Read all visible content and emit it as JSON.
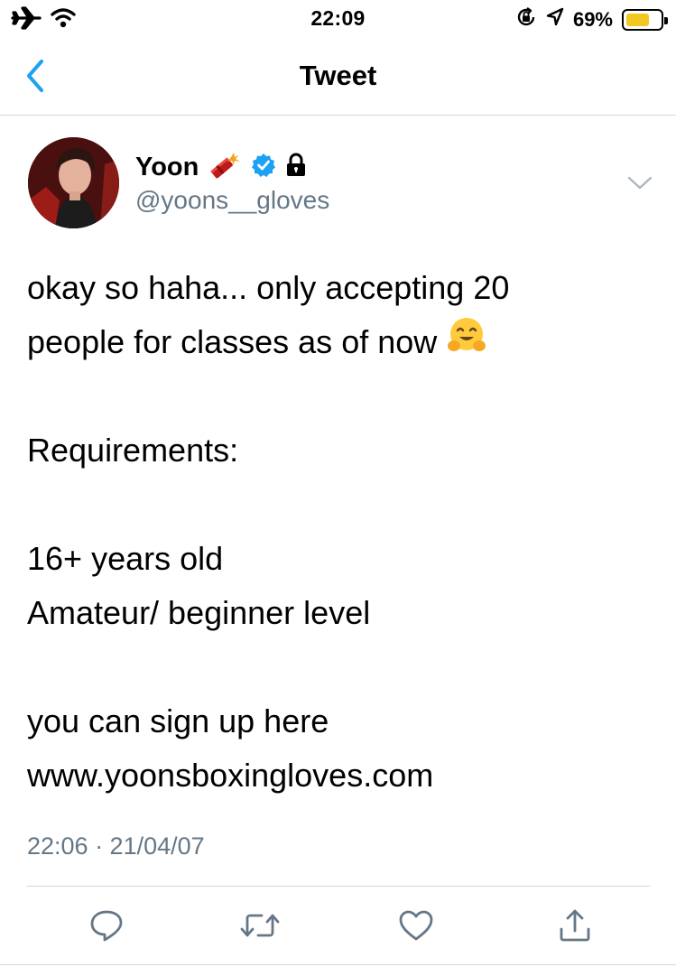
{
  "status_bar": {
    "time": "22:09",
    "battery_percent_label": "69%",
    "battery_level": 0.69,
    "battery_color": "#f3c622",
    "icons": [
      "airplane-icon",
      "wifi-icon",
      "orientation-lock-icon",
      "location-icon",
      "battery-icon"
    ]
  },
  "nav": {
    "title": "Tweet",
    "back_icon": "chevron-left-icon",
    "accent_color": "#1da1f2"
  },
  "tweet": {
    "author": {
      "display_name": "Yoon",
      "handle": "@yoons__gloves",
      "badges": [
        "firecracker-emoji",
        "verified-badge-icon",
        "lock-icon"
      ]
    },
    "lines": [
      "okay so haha... only accepting 20",
      "people for classes as of now",
      "",
      "Requirements:",
      "",
      "16+ years old",
      "Amateur/ beginner level",
      "",
      "you can sign up here",
      "www.yoonsboxingloves.com"
    ],
    "inline_emoji": "hugging-face-emoji",
    "timestamp": "22:06 · 21/04/07"
  },
  "actions": [
    {
      "name": "reply",
      "icon": "reply-icon"
    },
    {
      "name": "retweet",
      "icon": "retweet-icon"
    },
    {
      "name": "like",
      "icon": "heart-icon"
    },
    {
      "name": "share",
      "icon": "share-icon"
    }
  ],
  "colors": {
    "secondary_text": "#657786",
    "divider": "#d6d6d6",
    "verified": "#1da1f2"
  }
}
